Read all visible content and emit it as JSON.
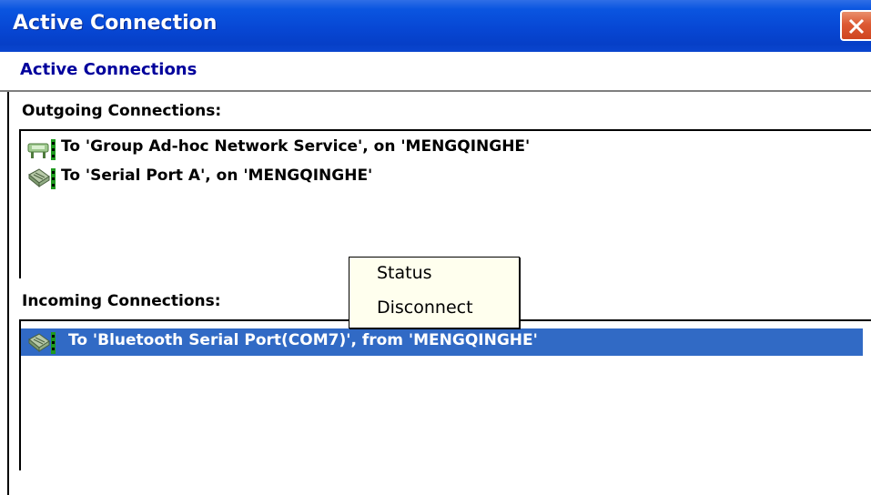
{
  "window": {
    "title": "Active Connection"
  },
  "header": {
    "title": "Active Connections"
  },
  "outgoing": {
    "label": "Outgoing Connections:",
    "items": [
      {
        "icon": "network-connection-icon",
        "label": "To 'Group Ad-hoc Network Service', on 'MENGQINGHE'"
      },
      {
        "icon": "serial-port-connection-icon",
        "label": "To 'Serial Port A', on 'MENGQINGHE'"
      }
    ]
  },
  "incoming": {
    "label": "Incoming Connections:",
    "items": [
      {
        "icon": "serial-port-connection-icon",
        "label": "To 'Bluetooth Serial Port(COM7)', from 'MENGQINGHE'",
        "selected": true
      }
    ]
  },
  "context_menu": {
    "items": [
      {
        "label": "Status"
      },
      {
        "label": "Disconnect"
      }
    ]
  },
  "colors": {
    "titlebar": "#0747d4",
    "header_text": "#00009c",
    "selection": "#316ac5",
    "menu_bg": "#ffffee",
    "close_button": "#dd5a33"
  }
}
